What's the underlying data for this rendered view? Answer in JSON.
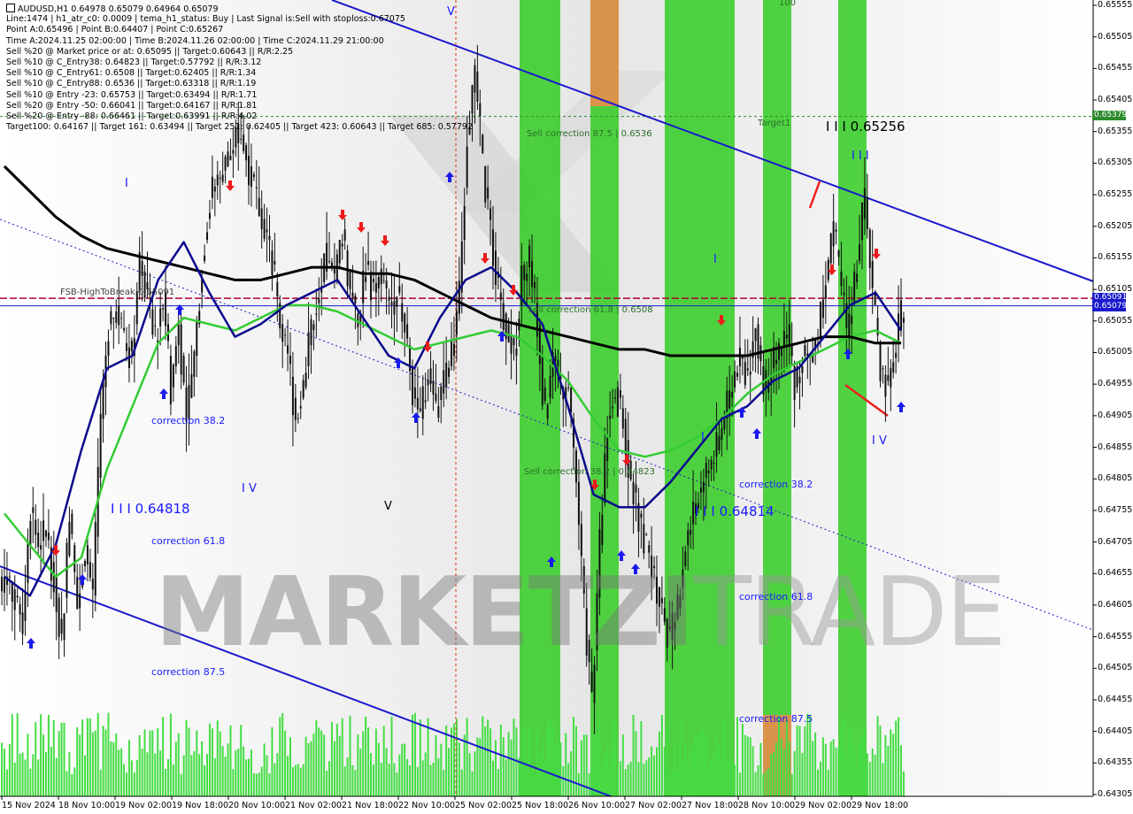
{
  "info": {
    "title": "AUDUSD,H1  0.64978 0.65079 0.64964 0.65079",
    "lines": [
      "Line:1474 | h1_atr_c0: 0.0009 | tema_h1_status: Buy | Last Signal is:Sell with stoploss:0.67075",
      "Point A:0.65496 | Point B:0.64407 | Point C:0.65267",
      "Time A:2024.11.25 02:00:00 | Time B:2024.11.26 02:00:00 | Time C:2024.11.29 21:00:00",
      "Sell %20 @ Market price or at: 0.65095 || Target:0.60643 || R/R:2.25",
      "Sell %10 @ C_Entry38: 0.64823 || Target:0.57792 || R/R:3.12",
      "Sell %10 @ C_Entry61: 0.6508 || Target:0.62405 || R/R:1.34",
      "Sell %10 @ C_Entry88: 0.6536 || Target:0.63318 || R/R:1.19",
      "Sell %10 @ Entry -23: 0.65753 || Target:0.63494 || R/R:1.71",
      "Sell %20 @ Entry -50: 0.66041 || Target:0.64167 || R/R:1.81",
      "Sell %20 @ Entry -88: 0.66461 || Target:0.63991 || R/R:4.02",
      "Target100: 0.64167 || Target 161: 0.63494 || Target 251: 0.62405 || Target 423: 0.60643 || Target 685: 0.57792"
    ]
  },
  "annotations": {
    "fsb": "FSB-HighToBreak",
    "fsb_val": "0.65091",
    "corr38_left": "correction 38.2",
    "corr61_left": "correction 61.8",
    "corr875_left": "correction 87.5",
    "corr38_right": "correction 38.2",
    "corr61_right": "correction 61.8",
    "corr875_right": "correction 87.5",
    "lvl_left": "I I I 0.64818",
    "lvl_mid": "I I I 0.64814",
    "lvl_top": "I I I 0.65256",
    "sell_corr875": "Sell correction 87.5 | 0.6536",
    "sell_corr618": "Sell correction 61.8 | 0.6508",
    "sell_corr382": "Sell correction 38.2 | 0.64823",
    "target1": "Target1",
    "top100": "100",
    "wave_I": "I",
    "wave_IV_left": "I V",
    "wave_V_left": "V",
    "wave_V_top": "V",
    "wave_I_mid": "I",
    "wave_I_mid2": "I",
    "wave_III_top": "I I I",
    "wave_IV_right": "I V"
  },
  "price_tags": {
    "target": "0.65379",
    "fsb": "0.65091",
    "last": "0.65079"
  },
  "watermark": {
    "bold": "MARKETZI",
    "thin": "TRADE"
  },
  "colors": {
    "green_zone": "#33cc22",
    "orange_zone": "#d9924a",
    "ma_black": "#000000",
    "ma_green": "#33cc33",
    "ma_blue": "#0a0a8c",
    "channel": "#1a1acc",
    "volume": "#44dd44",
    "fsb_line": "#b00030",
    "bid_tag": "#1a1acc"
  },
  "chart_data": {
    "type": "candlestick",
    "symbol": "AUDUSD",
    "timeframe": "H1",
    "ylim": [
      0.64305,
      0.65555
    ],
    "y_ticks": [
      "0.65555",
      "0.65505",
      "0.65455",
      "0.65405",
      "0.65355",
      "0.65305",
      "0.65255",
      "0.65205",
      "0.65155",
      "0.65105",
      "0.65055",
      "0.65005",
      "0.64955",
      "0.64905",
      "0.64855",
      "0.64805",
      "0.64755",
      "0.64705",
      "0.64655",
      "0.64605",
      "0.64555",
      "0.64505",
      "0.64455",
      "0.64405",
      "0.64355",
      "0.64305"
    ],
    "x_ticks": [
      "15 Nov 2024",
      "18 Nov 10:00",
      "19 Nov 02:00",
      "19 Nov 18:00",
      "20 Nov 10:00",
      "21 Nov 02:00",
      "21 Nov 18:00",
      "22 Nov 10:00",
      "25 Nov 02:00",
      "25 Nov 18:00",
      "26 Nov 10:00",
      "27 Nov 02:00",
      "27 Nov 18:00",
      "28 Nov 10:00",
      "29 Nov 02:00",
      "29 Nov 18:00"
    ],
    "levels": {
      "target": 0.65379,
      "fsb_high_to_break": 0.65091,
      "last": 0.65079
    },
    "ohlc_path": [
      0.6465,
      0.6462,
      0.6458,
      0.6476,
      0.647,
      0.6472,
      0.6465,
      0.6455,
      0.6475,
      0.646,
      0.647,
      0.6462,
      0.649,
      0.6505,
      0.6508,
      0.6502,
      0.65,
      0.6515,
      0.651,
      0.6502,
      0.651,
      0.6495,
      0.6505,
      0.649,
      0.65,
      0.6515,
      0.6525,
      0.6528,
      0.653,
      0.6533,
      0.6535,
      0.653,
      0.6525,
      0.652,
      0.6515,
      0.6505,
      0.65,
      0.649,
      0.6495,
      0.6505,
      0.651,
      0.6515,
      0.6512,
      0.652,
      0.651,
      0.6505,
      0.6515,
      0.651,
      0.6512,
      0.6508,
      0.651,
      0.6505,
      0.6495,
      0.649,
      0.6498,
      0.6492,
      0.6495,
      0.65,
      0.651,
      0.6535,
      0.6545,
      0.653,
      0.652,
      0.651,
      0.6505,
      0.65,
      0.6512,
      0.6515,
      0.6505,
      0.649,
      0.65,
      0.6495,
      0.6495,
      0.648,
      0.646,
      0.6445,
      0.647,
      0.649,
      0.6495,
      0.649,
      0.648,
      0.6475,
      0.647,
      0.6465,
      0.646,
      0.6455,
      0.646,
      0.647,
      0.6475,
      0.648,
      0.6482,
      0.6485,
      0.649,
      0.6495,
      0.65,
      0.6497,
      0.6505,
      0.6495,
      0.6498,
      0.65,
      0.6505,
      0.6495,
      0.65,
      0.65,
      0.6503,
      0.6512,
      0.652,
      0.651,
      0.6505,
      0.6515,
      0.6525,
      0.651,
      0.6498,
      0.6495,
      0.6502,
      0.6508
    ],
    "ma_black": [
      0.653,
      0.6526,
      0.6522,
      0.6519,
      0.6517,
      0.6516,
      0.6515,
      0.6514,
      0.6513,
      0.6512,
      0.6512,
      0.6513,
      0.6514,
      0.6514,
      0.6513,
      0.6513,
      0.6512,
      0.651,
      0.6508,
      0.6506,
      0.6505,
      0.6504,
      0.6503,
      0.6502,
      0.6501,
      0.6501,
      0.65,
      0.65,
      0.65,
      0.65,
      0.6501,
      0.6502,
      0.6503,
      0.6503,
      0.6502,
      0.6502
    ],
    "ma_blue": [
      0.6465,
      0.6462,
      0.647,
      0.6485,
      0.6498,
      0.65,
      0.6512,
      0.6518,
      0.651,
      0.6503,
      0.6505,
      0.6508,
      0.651,
      0.6512,
      0.6506,
      0.65,
      0.6498,
      0.6506,
      0.6512,
      0.6514,
      0.651,
      0.6505,
      0.6492,
      0.6478,
      0.6476,
      0.6476,
      0.648,
      0.6485,
      0.649,
      0.6492,
      0.6496,
      0.6498,
      0.6503,
      0.6508,
      0.651,
      0.6504
    ],
    "ma_green": [
      0.6475,
      0.647,
      0.6465,
      0.6468,
      0.6482,
      0.6492,
      0.6502,
      0.6506,
      0.6505,
      0.6504,
      0.6506,
      0.6508,
      0.6508,
      0.6507,
      0.6505,
      0.6503,
      0.6501,
      0.6502,
      0.6503,
      0.6504,
      0.6503,
      0.65,
      0.6496,
      0.649,
      0.6485,
      0.6484,
      0.6485,
      0.6487,
      0.649,
      0.6494,
      0.6497,
      0.6499,
      0.6501,
      0.6503,
      0.6504,
      0.6502
    ]
  }
}
